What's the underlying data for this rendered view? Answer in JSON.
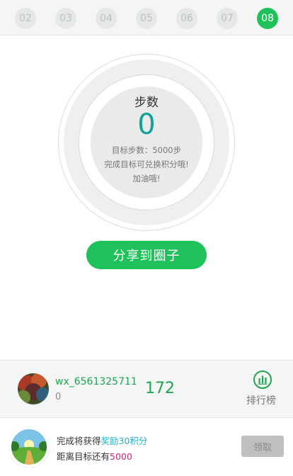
{
  "date_strip": {
    "days": [
      {
        "label": "02",
        "active": false
      },
      {
        "label": "03",
        "active": false
      },
      {
        "label": "04",
        "active": false
      },
      {
        "label": "05",
        "active": false
      },
      {
        "label": "06",
        "active": false
      },
      {
        "label": "07",
        "active": false
      },
      {
        "label": "08",
        "active": true
      }
    ]
  },
  "steps_panel": {
    "title": "步数",
    "count": "0",
    "goal_line": "目标步数：5000步",
    "hint_line": "完成目标可兑换积分哦!",
    "cheer_line": "加油哦!"
  },
  "share_button": {
    "label": "分享到圈子"
  },
  "user_bar": {
    "username": "wx_6561325711",
    "sub_value": "0",
    "steps_value": "172",
    "ranking_label": "排行榜",
    "icon": "bar-chart-icon"
  },
  "reward_bar": {
    "line1_prefix": "完成将获得",
    "line1_highlight": "奖励30积分",
    "line2_prefix": "距离目标还有",
    "line2_highlight": "5000",
    "claim_label": "领取"
  },
  "colors": {
    "accent_green": "#1fc25a",
    "count_teal": "#13a19a",
    "highlight_blue": "#24b0c9",
    "highlight_pink": "#c9287c",
    "disabled_gray": "#bfbfbf"
  }
}
